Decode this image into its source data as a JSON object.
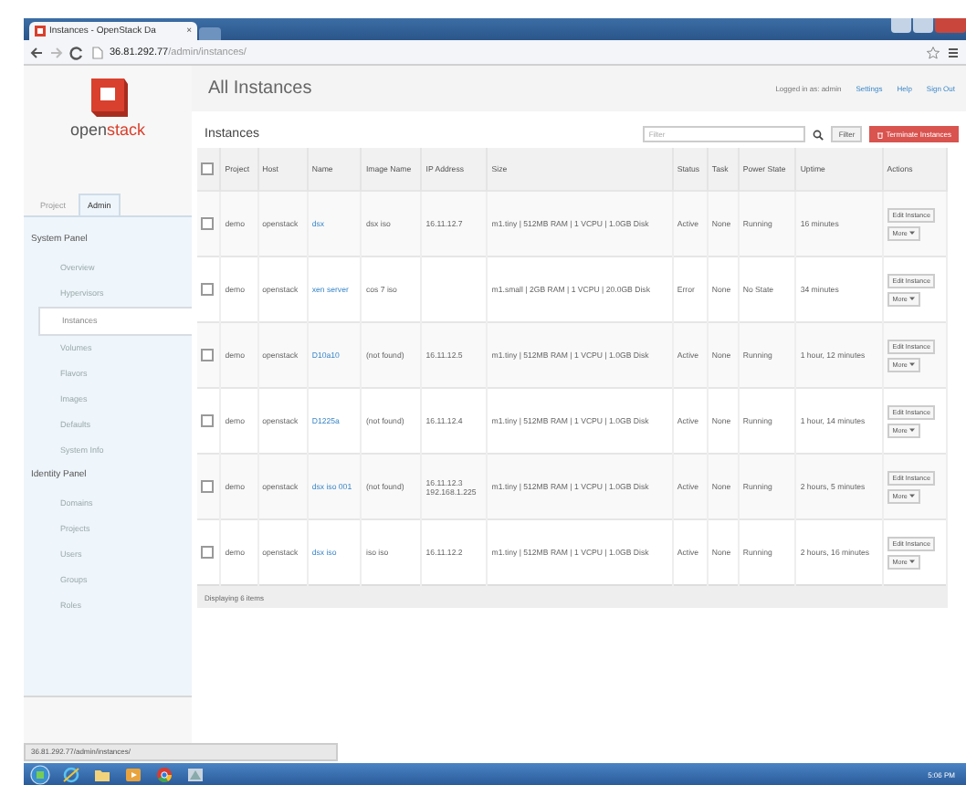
{
  "browser": {
    "tab_title": "Instances - OpenStack Da",
    "tab_close": "×",
    "url_host": "36.81.292.77",
    "url_path": "/admin/instances/"
  },
  "logo_text": [
    "open",
    "stack"
  ],
  "header": {
    "title": "All Instances",
    "user": "Logged in as: admin",
    "links": [
      "Settings",
      "Help",
      "Sign Out"
    ]
  },
  "sidebar": {
    "tabs": [
      {
        "label": "Project",
        "selected": false
      },
      {
        "label": "Admin",
        "selected": true
      }
    ],
    "panels": [
      {
        "title": "System Panel",
        "items": [
          {
            "label": "Overview",
            "selected": false
          },
          {
            "label": "Hypervisors",
            "selected": false
          },
          {
            "label": "Instances",
            "selected": true
          },
          {
            "label": "Volumes",
            "selected": false
          },
          {
            "label": "Flavors",
            "selected": false
          },
          {
            "label": "Images",
            "selected": false
          },
          {
            "label": "Defaults",
            "selected": false
          },
          {
            "label": "System Info",
            "selected": false
          }
        ]
      },
      {
        "title": "Identity Panel",
        "items": [
          {
            "label": "Domains",
            "selected": false
          },
          {
            "label": "Projects",
            "selected": false
          },
          {
            "label": "Users",
            "selected": false
          },
          {
            "label": "Groups",
            "selected": false
          },
          {
            "label": "Roles",
            "selected": false
          }
        ]
      }
    ]
  },
  "section_title": "Instances",
  "filter": {
    "placeholder": "Filter",
    "button": "Filter"
  },
  "terminate_button": "Terminate Instances",
  "table": {
    "select_all_checked": false,
    "columns": [
      "Project",
      "Host",
      "Name",
      "Image Name",
      "IP Address",
      "Size",
      "Status",
      "Task",
      "Power State",
      "Uptime",
      "Actions"
    ],
    "rows": [
      {
        "checked": false,
        "project": "demo",
        "host": "openstack",
        "name": "dsx",
        "image": "dsx iso",
        "ip": [
          "16.11.12.7"
        ],
        "size": "m1.tiny | 512MB RAM | 1 VCPU | 1.0GB Disk",
        "status": "Active",
        "task": "None",
        "power": "Running",
        "uptime": "16 minutes",
        "actions": [
          "Edit Instance",
          "More"
        ]
      },
      {
        "checked": false,
        "project": "demo",
        "host": "openstack",
        "name": "xen server",
        "image": "cos 7 iso",
        "ip": [],
        "size": "m1.small | 2GB RAM | 1 VCPU | 20.0GB Disk",
        "status": "Error",
        "task": "None",
        "power": "No State",
        "uptime": "34 minutes",
        "actions": [
          "Edit Instance",
          "More"
        ]
      },
      {
        "checked": false,
        "project": "demo",
        "host": "openstack",
        "name": "D10a10",
        "image": "(not found)",
        "ip": [
          "16.11.12.5"
        ],
        "size": "m1.tiny | 512MB RAM | 1 VCPU | 1.0GB Disk",
        "status": "Active",
        "task": "None",
        "power": "Running",
        "uptime": "1 hour, 12 minutes",
        "actions": [
          "Edit Instance",
          "More"
        ]
      },
      {
        "checked": false,
        "project": "demo",
        "host": "openstack",
        "name": "D1225a",
        "image": "(not found)",
        "ip": [
          "16.11.12.4"
        ],
        "size": "m1.tiny | 512MB RAM | 1 VCPU | 1.0GB Disk",
        "status": "Active",
        "task": "None",
        "power": "Running",
        "uptime": "1 hour, 14 minutes",
        "actions": [
          "Edit Instance",
          "More"
        ]
      },
      {
        "checked": false,
        "project": "demo",
        "host": "openstack",
        "name": "dsx iso 001",
        "image": "(not found)",
        "ip": [
          "16.11.12.3",
          "192.168.1.225"
        ],
        "size": "m1.tiny | 512MB RAM | 1 VCPU | 1.0GB Disk",
        "status": "Active",
        "task": "None",
        "power": "Running",
        "uptime": "2 hours, 5 minutes",
        "actions": [
          "Edit Instance",
          "More"
        ]
      },
      {
        "checked": false,
        "project": "demo",
        "host": "openstack",
        "name": "dsx iso",
        "image": "iso iso",
        "ip": [
          "16.11.12.2"
        ],
        "size": "m1.tiny | 512MB RAM | 1 VCPU | 1.0GB Disk",
        "status": "Active",
        "task": "None",
        "power": "Running",
        "uptime": "2 hours, 16 minutes",
        "actions": [
          "Edit Instance",
          "More"
        ]
      }
    ],
    "footer": "Displaying 6 items"
  },
  "status_url": "36.81.292.77/admin/instances/",
  "taskbar": {
    "clock": "5:06 PM"
  }
}
